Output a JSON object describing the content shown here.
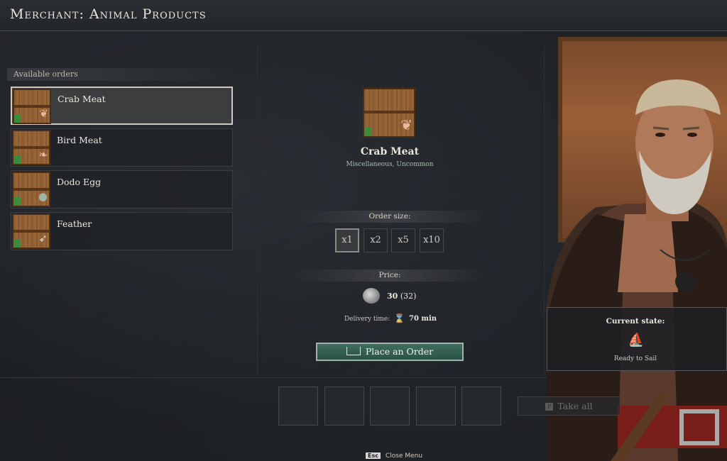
{
  "header": {
    "title": "Merchant: Animal Products"
  },
  "orders": {
    "section_label": "Available orders",
    "items": [
      {
        "label": "Crab Meat",
        "icon": "crab-meat-crate-icon",
        "selected": true
      },
      {
        "label": "Bird Meat",
        "icon": "bird-meat-crate-icon",
        "selected": false
      },
      {
        "label": "Dodo Egg",
        "icon": "dodo-egg-crate-icon",
        "selected": false
      },
      {
        "label": "Feather",
        "icon": "feather-crate-icon",
        "selected": false
      }
    ]
  },
  "detail": {
    "name": "Crab Meat",
    "subtitle": "Miscellaneous, Uncommon",
    "order_size_label": "Order size:",
    "sizes": [
      "x1",
      "x2",
      "x5",
      "x10"
    ],
    "selected_size": "x1",
    "price_label": "Price:",
    "price_value": "30",
    "price_original": "(32)",
    "delivery_label": "Delivery time:",
    "delivery_value": "70 min",
    "order_button": "Place an Order"
  },
  "slots": {
    "count": 5
  },
  "take_all": {
    "key": "F",
    "label": "Take all"
  },
  "state": {
    "title": "Current state:",
    "icon": "ship-icon",
    "value": "Ready to Sail"
  },
  "footer": {
    "key": "Esc",
    "label": "Close Menu"
  },
  "colors": {
    "accent_green": "#2f5a4a",
    "selected_border": "#cfcac0",
    "subtitle_green": "#9fc3a9"
  }
}
